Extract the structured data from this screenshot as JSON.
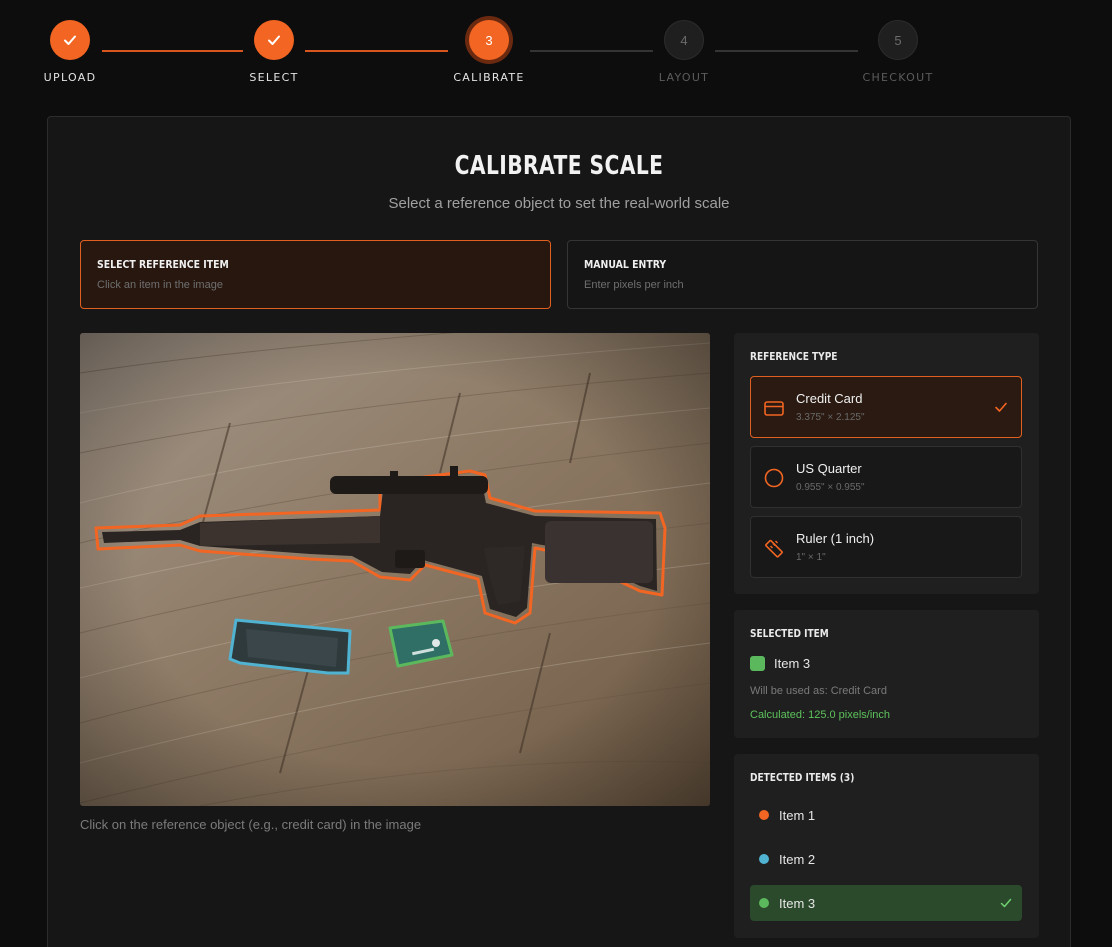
{
  "stepper": {
    "steps": [
      {
        "label": "UPLOAD",
        "state": "done",
        "number": "1"
      },
      {
        "label": "SELECT",
        "state": "done",
        "number": "2"
      },
      {
        "label": "CALIBRATE",
        "state": "active",
        "number": "3"
      },
      {
        "label": "LAYOUT",
        "state": "todo",
        "number": "4"
      },
      {
        "label": "CHECKOUT",
        "state": "todo",
        "number": "5"
      }
    ]
  },
  "header": {
    "title": "CALIBRATE SCALE",
    "subtitle": "Select a reference object to set the real-world scale"
  },
  "modes": {
    "select_ref": {
      "title": "SELECT REFERENCE ITEM",
      "subtitle": "Click an item in the image"
    },
    "manual": {
      "title": "MANUAL ENTRY",
      "subtitle": "Enter pixels per inch"
    }
  },
  "image": {
    "hint": "Click on the reference object (e.g., credit card) in the image"
  },
  "reference_type": {
    "title": "REFERENCE TYPE",
    "options": [
      {
        "name": "Credit Card",
        "dims": "3.375\" × 2.125\"",
        "icon": "credit-card-icon",
        "selected": true
      },
      {
        "name": "US Quarter",
        "dims": "0.955\" × 0.955\"",
        "icon": "coin-icon",
        "selected": false
      },
      {
        "name": "Ruler (1 inch)",
        "dims": "1\" × 1\"",
        "icon": "ruler-icon",
        "selected": false
      }
    ]
  },
  "selected_item": {
    "title": "SELECTED ITEM",
    "name": "Item 3",
    "use_as": "Will be used as: Credit Card",
    "calculated": "Calculated: 125.0 pixels/inch"
  },
  "detected": {
    "title": "DETECTED ITEMS (3)",
    "items": [
      {
        "name": "Item 1",
        "color": "#f26522",
        "selected": false
      },
      {
        "name": "Item 2",
        "color": "#4fb3d1",
        "selected": false
      },
      {
        "name": "Item 3",
        "color": "#5cb85c",
        "selected": true
      }
    ]
  },
  "colors": {
    "accent": "#f26522",
    "success": "#5cb85c",
    "item2": "#4fb3d1"
  }
}
